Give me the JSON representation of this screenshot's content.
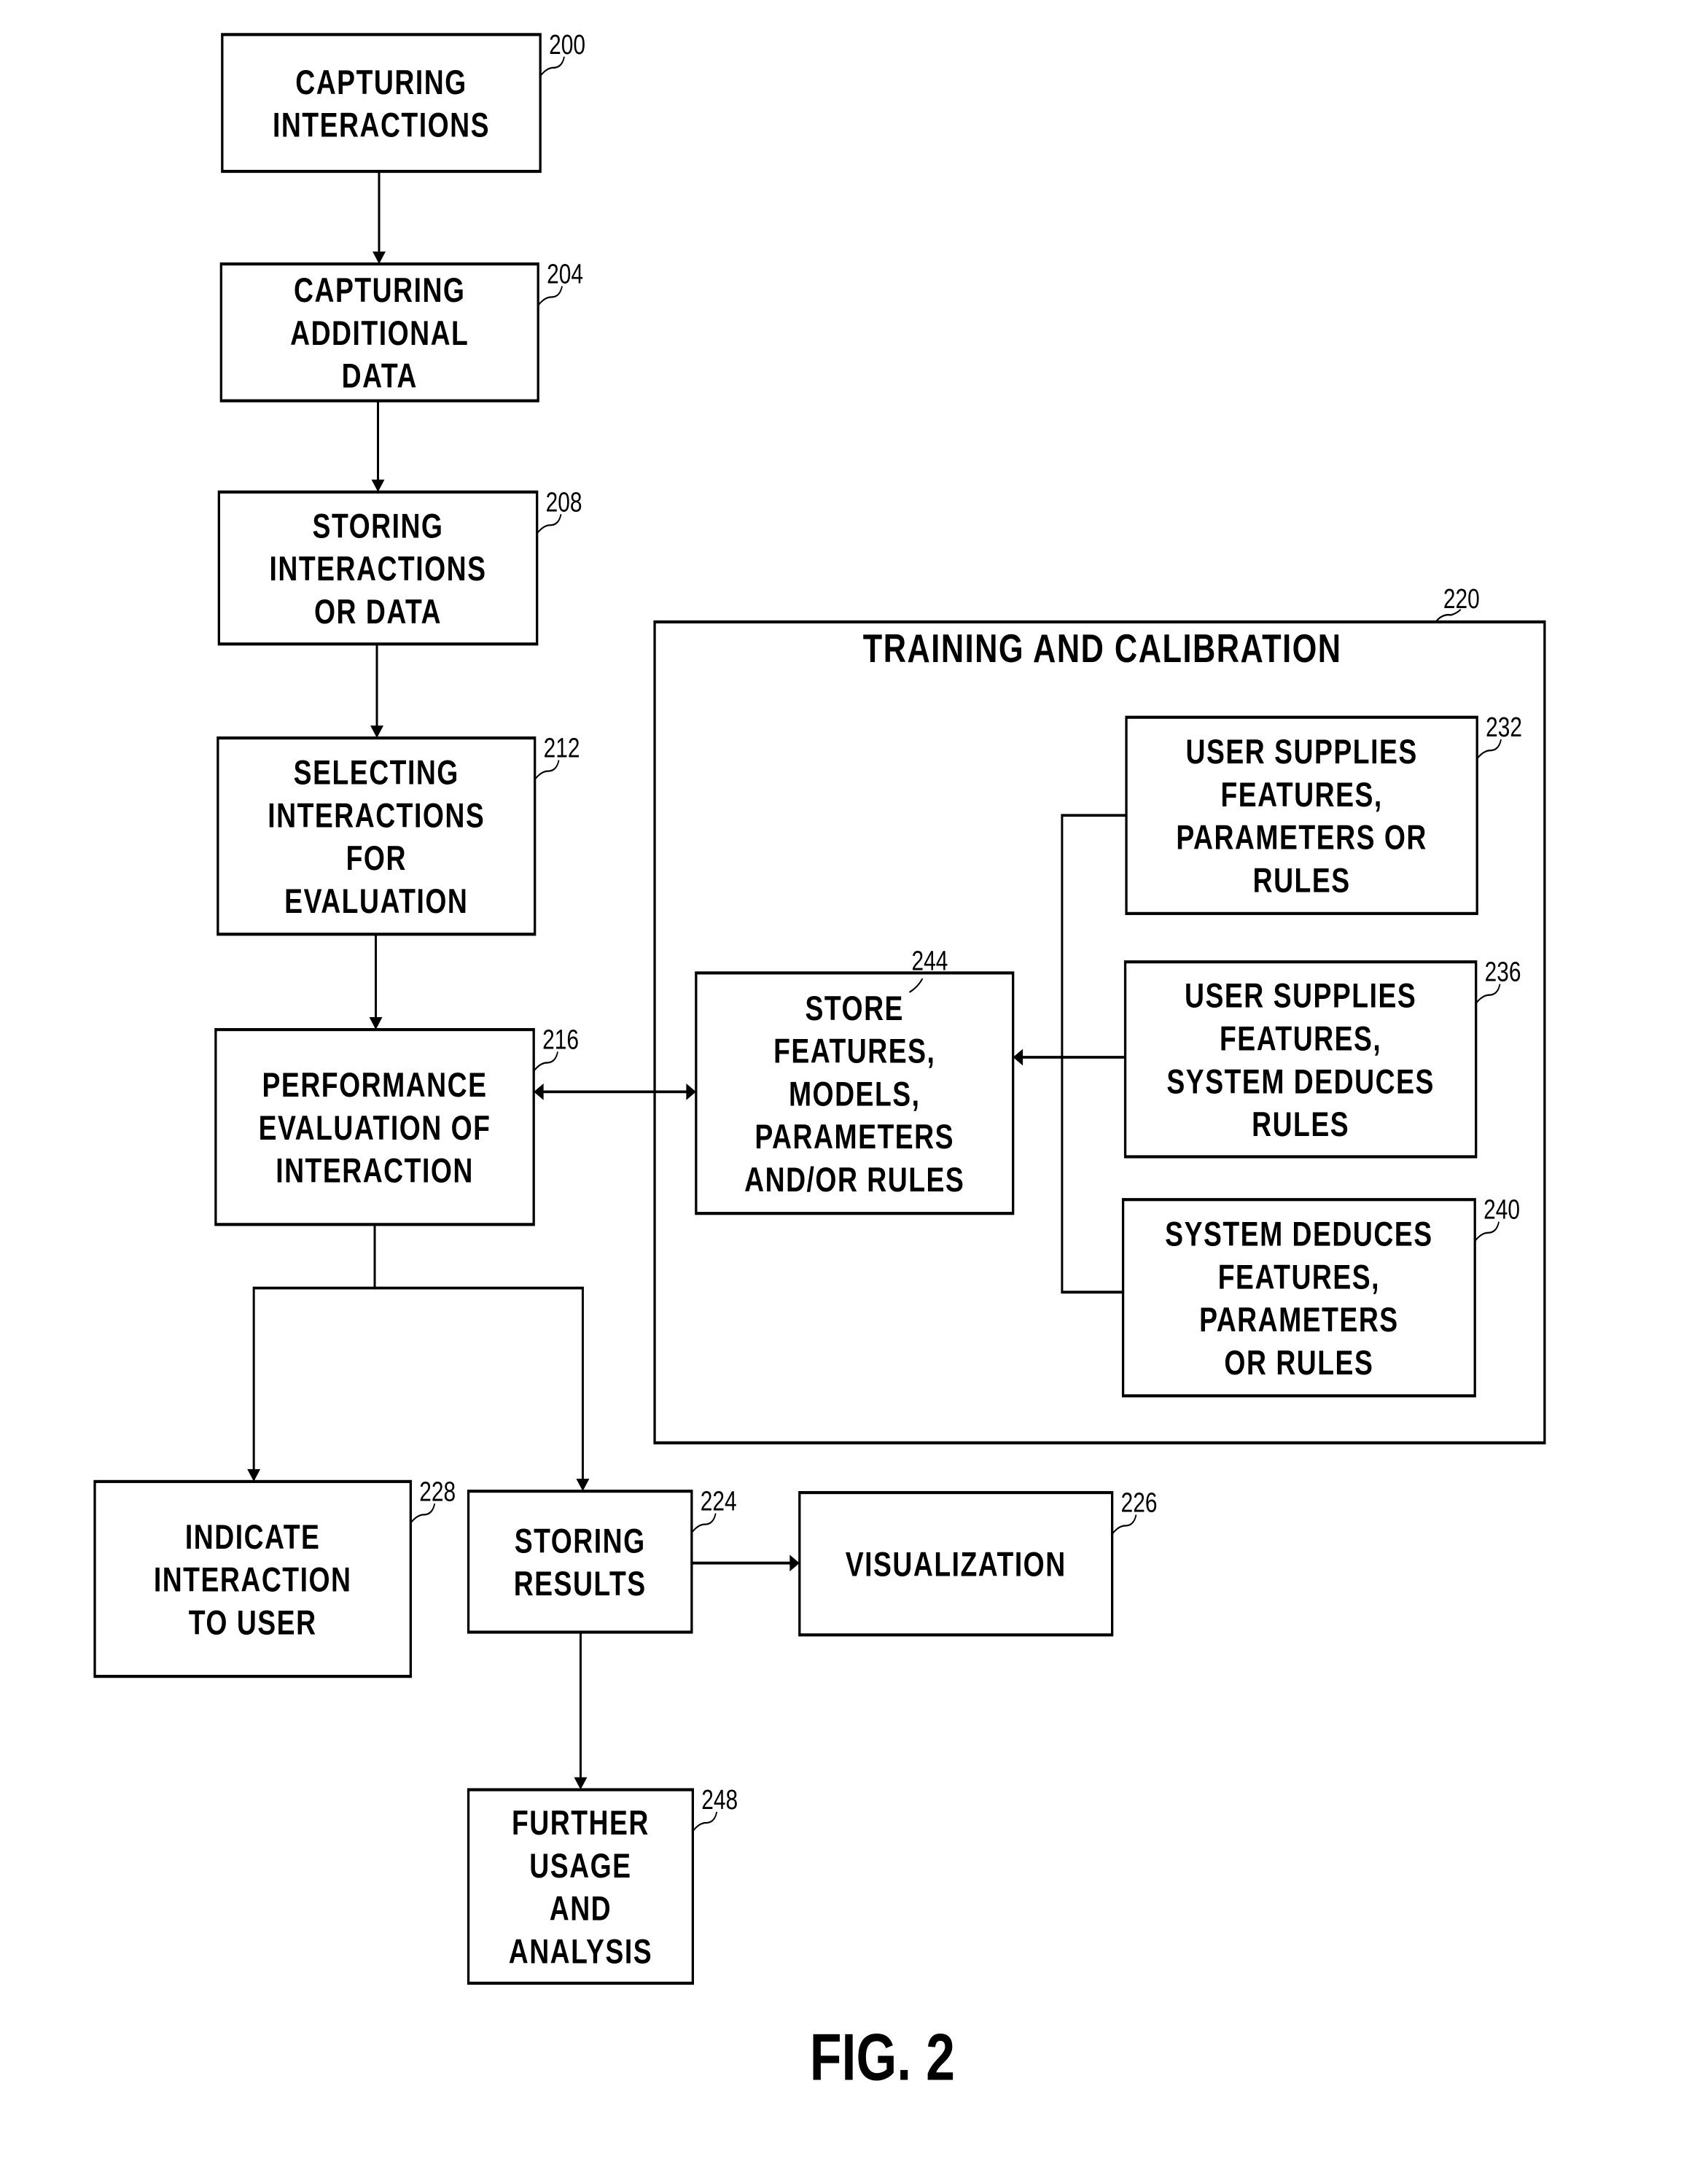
{
  "figure_label": "FIG. 2",
  "container": {
    "ref": "220",
    "title": "TRAINING AND CALIBRATION"
  },
  "boxes": {
    "b200": {
      "ref": "200",
      "lines": [
        "CAPTURING",
        "INTERACTIONS"
      ]
    },
    "b204": {
      "ref": "204",
      "lines": [
        "CAPTURING",
        "ADDITIONAL",
        "DATA"
      ]
    },
    "b208": {
      "ref": "208",
      "lines": [
        "STORING",
        "INTERACTIONS",
        "OR DATA"
      ]
    },
    "b212": {
      "ref": "212",
      "lines": [
        "SELECTING",
        "INTERACTIONS",
        "FOR",
        "EVALUATION"
      ]
    },
    "b216": {
      "ref": "216",
      "lines": [
        "PERFORMANCE",
        "EVALUATION OF",
        "INTERACTION"
      ]
    },
    "b244": {
      "ref": "244",
      "lines": [
        "STORE",
        "FEATURES,",
        "MODELS,",
        "PARAMETERS",
        "AND/OR RULES"
      ]
    },
    "b232": {
      "ref": "232",
      "lines": [
        "USER SUPPLIES",
        "FEATURES,",
        "PARAMETERS OR",
        "RULES"
      ]
    },
    "b236": {
      "ref": "236",
      "lines": [
        "USER SUPPLIES",
        "FEATURES,",
        "SYSTEM DEDUCES",
        "RULES"
      ]
    },
    "b240": {
      "ref": "240",
      "lines": [
        "SYSTEM DEDUCES",
        "FEATURES,",
        "PARAMETERS",
        "OR RULES"
      ]
    },
    "b228": {
      "ref": "228",
      "lines": [
        "INDICATE",
        "INTERACTION",
        "TO USER"
      ]
    },
    "b224": {
      "ref": "224",
      "lines": [
        "STORING",
        "RESULTS"
      ]
    },
    "b226": {
      "ref": "226",
      "lines": [
        "VISUALIZATION"
      ]
    },
    "b248": {
      "ref": "248",
      "lines": [
        "FURTHER",
        "USAGE",
        "AND",
        "ANALYSIS"
      ]
    }
  },
  "connections": [
    {
      "from": "200",
      "to": "204",
      "type": "arrow"
    },
    {
      "from": "204",
      "to": "208",
      "type": "arrow"
    },
    {
      "from": "208",
      "to": "212",
      "type": "arrow"
    },
    {
      "from": "212",
      "to": "216",
      "type": "arrow"
    },
    {
      "from": "216",
      "to": "244",
      "type": "bidirectional"
    },
    {
      "from": "232",
      "to": "244",
      "type": "arrow"
    },
    {
      "from": "236",
      "to": "244",
      "type": "arrow"
    },
    {
      "from": "240",
      "to": "244",
      "type": "arrow"
    },
    {
      "from": "216",
      "to": "228",
      "type": "arrow"
    },
    {
      "from": "216",
      "to": "224",
      "type": "arrow"
    },
    {
      "from": "224",
      "to": "226",
      "type": "arrow"
    },
    {
      "from": "224",
      "to": "248",
      "type": "arrow"
    }
  ]
}
